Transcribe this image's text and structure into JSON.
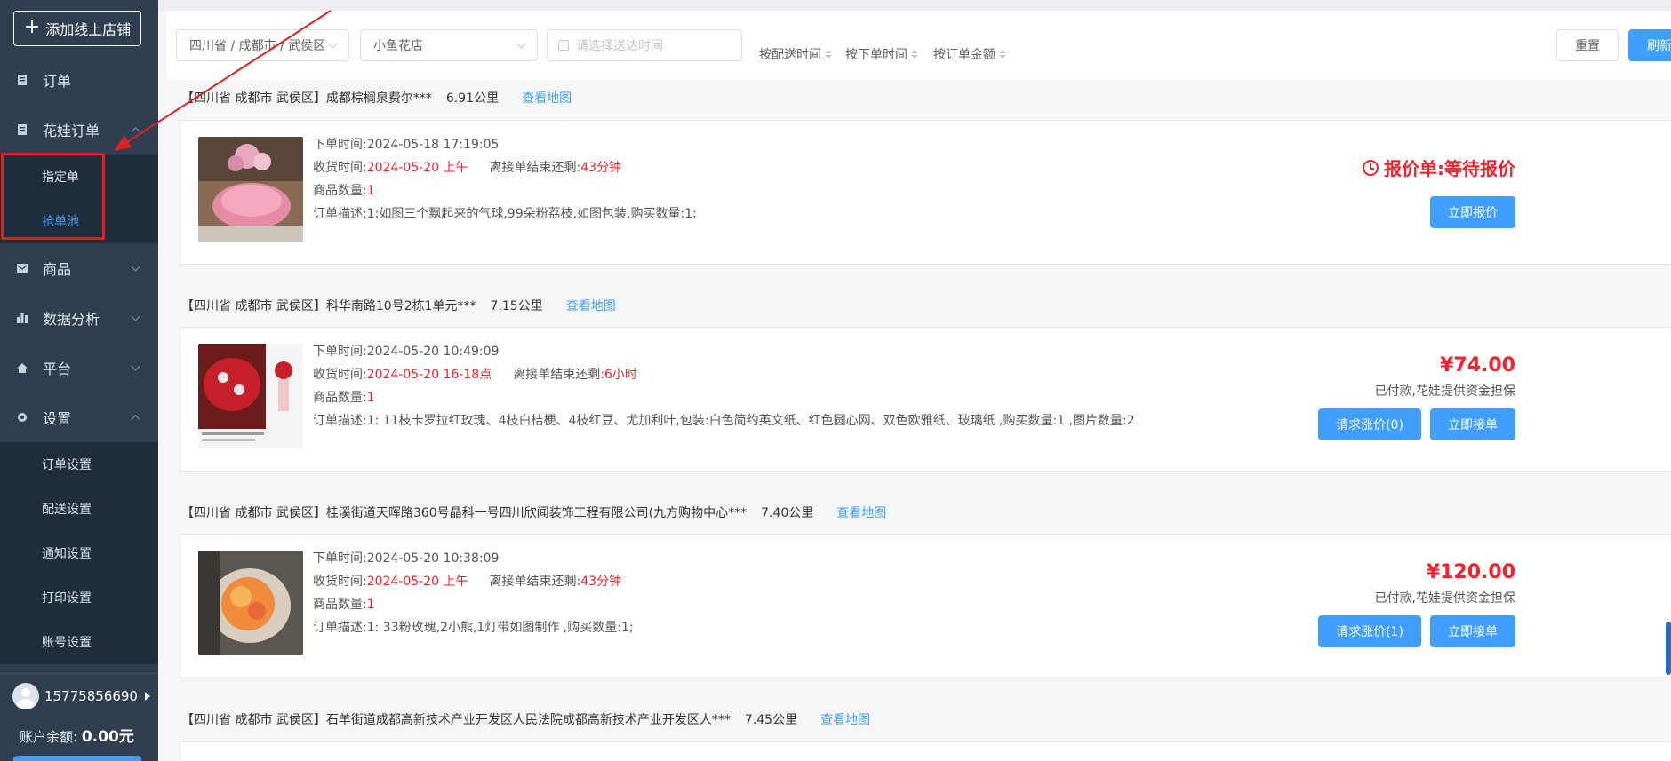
{
  "sidebar": {
    "add_store_label": "添加线上店铺",
    "menu": {
      "orders": "订单",
      "flower_orders": "花娃订单",
      "designated": "指定单",
      "grab_pool": "抢单池",
      "goods": "商品",
      "analytics": "数据分析",
      "platform": "平台",
      "settings": "设置",
      "order_settings": "订单设置",
      "delivery_settings": "配送设置",
      "notify_settings": "通知设置",
      "print_settings": "打印设置",
      "account_settings": "账号设置"
    },
    "user_phone": "15775856690",
    "balance_label": "账户余额:",
    "balance_value": "0.00元"
  },
  "filters": {
    "region": "四川省 / 成都市 / 武侯区",
    "shop": "小鱼花店",
    "date_placeholder": "请选择送达时间",
    "sort_delivery": "按配送时间",
    "sort_order_time": "按下单时间",
    "sort_amount": "按订单金额",
    "reset": "重置",
    "refresh": "刷新"
  },
  "labels": {
    "order_time": "下单时间:",
    "receive_time": "收货时间:",
    "remaining": "离接单结束还剩:",
    "quantity": "商品数量:",
    "description": "订单描述:",
    "view_map": "查看地图",
    "paid_note": "已付款,花娃提供资金担保"
  },
  "orders": [
    {
      "address": "【四川省 成都市 武侯区】成都棕榈泉费尔***",
      "distance": "6.91公里",
      "order_time": "2024-05-18 17:19:05",
      "receive_time": "2024-05-20 上午",
      "remaining": "43分钟",
      "quantity": "1",
      "description": "1:如图三个飘起来的气球,99朵粉荔枝,如图包装,购买数量:1;",
      "status": "报价单:等待报价",
      "action": "立即报价"
    },
    {
      "address": "【四川省 成都市 武侯区】科华南路10号2栋1单元***",
      "distance": "7.15公里",
      "order_time": "2024-05-20 10:49:09",
      "receive_time": "2024-05-20 16-18点",
      "remaining": "6小时",
      "quantity": "1",
      "description": "1: 11枝卡罗拉红玫瑰、4枝白桔梗、4枝红豆、尤加利叶,包装:白色简约英文纸、红色圆心网、双色欧雅纸、玻璃纸 ,购买数量:1 ,图片数量:2",
      "price": "¥74.00",
      "raise_btn": "请求涨价(0)",
      "action": "立即接单"
    },
    {
      "address": "【四川省 成都市 武侯区】桂溪街道天晖路360号晶科一号四川欣闻装饰工程有限公司(九方购物中心***",
      "distance": "7.40公里",
      "order_time": "2024-05-20 10:38:09",
      "receive_time": "2024-05-20 上午",
      "remaining": "43分钟",
      "quantity": "1",
      "description": "1: 33粉玫瑰,2小熊,1灯带如图制作 ,购买数量:1;",
      "price": "¥120.00",
      "raise_btn": "请求涨价(1)",
      "action": "立即接单"
    },
    {
      "address": "【四川省 成都市 武侯区】石羊街道成都高新技术产业开发区人民法院成都高新技术产业开发区人***",
      "distance": "7.45公里"
    }
  ]
}
